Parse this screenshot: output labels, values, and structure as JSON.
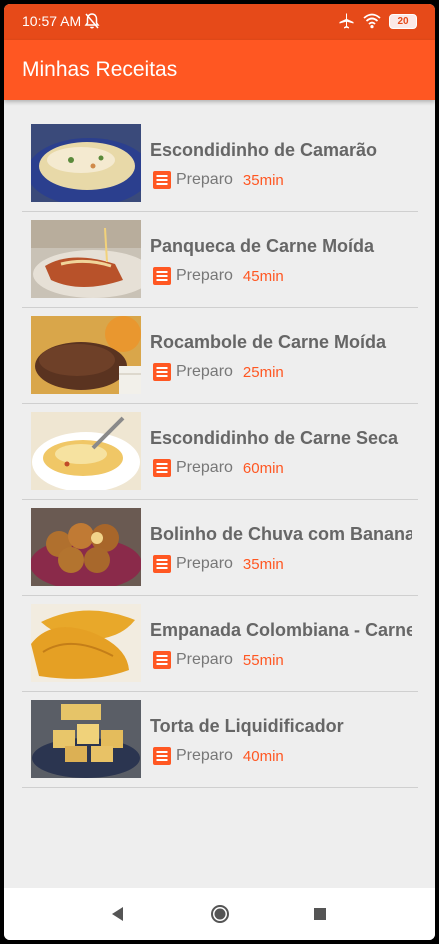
{
  "status_bar": {
    "time": "10:57 AM",
    "battery": "20",
    "icons": [
      "bell-off-icon",
      "airplane-icon",
      "wifi-icon",
      "battery-icon"
    ]
  },
  "app_bar": {
    "title": "Minhas Receitas"
  },
  "colors": {
    "primary": "#ff5722",
    "status_bar": "#e64a19",
    "background": "#eeeeee",
    "recipe_title": "#666666"
  },
  "recipes": [
    {
      "name": "Escondidinho de Camarão",
      "prep_label": "Preparo",
      "time": "35min"
    },
    {
      "name": "Panqueca de Carne Moída",
      "prep_label": "Preparo",
      "time": "45min"
    },
    {
      "name": "Rocambole de Carne Moída",
      "prep_label": "Preparo",
      "time": "25min"
    },
    {
      "name": "Escondidinho de Carne Seca",
      "prep_label": "Preparo",
      "time": "60min"
    },
    {
      "name": "Bolinho de Chuva com Banana",
      "prep_label": "Preparo",
      "time": "35min"
    },
    {
      "name": "Empanada Colombiana - Carne",
      "prep_label": "Preparo",
      "time": "55min"
    },
    {
      "name": "Torta de Liquidificador",
      "prep_label": "Preparo",
      "time": "40min"
    }
  ],
  "nav_bar": {
    "icons": [
      "back-icon",
      "home-icon",
      "recents-icon"
    ]
  }
}
